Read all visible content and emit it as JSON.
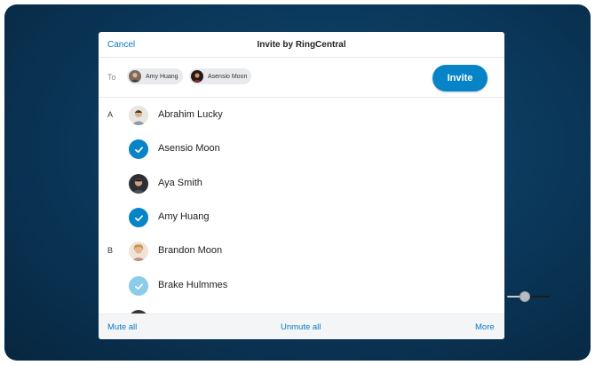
{
  "dialog": {
    "cancel_label": "Cancel",
    "title": "Invite by RingCentral",
    "to_label": "To",
    "invite_label": "Invite",
    "chips": [
      {
        "name": "Amy Huang"
      },
      {
        "name": "Asensio Moon"
      }
    ],
    "contacts": [
      {
        "letter": "A",
        "name": "Abrahim Lucky",
        "state": "avatar"
      },
      {
        "letter": "",
        "name": "Asensio Moon",
        "state": "selected"
      },
      {
        "letter": "",
        "name": "Aya Smith",
        "state": "avatar"
      },
      {
        "letter": "",
        "name": "Amy Huang",
        "state": "selected"
      },
      {
        "letter": "B",
        "name": "Brandon Moon",
        "state": "avatar"
      },
      {
        "letter": "",
        "name": "Brake Hulmmes",
        "state": "selected-light"
      }
    ],
    "footer": {
      "mute_all": "Mute all",
      "unmute_all": "Unmute all",
      "more": "More"
    }
  },
  "colors": {
    "accent": "#0684c7",
    "accent_light": "#8ccbe9",
    "background": "#0a3658"
  }
}
